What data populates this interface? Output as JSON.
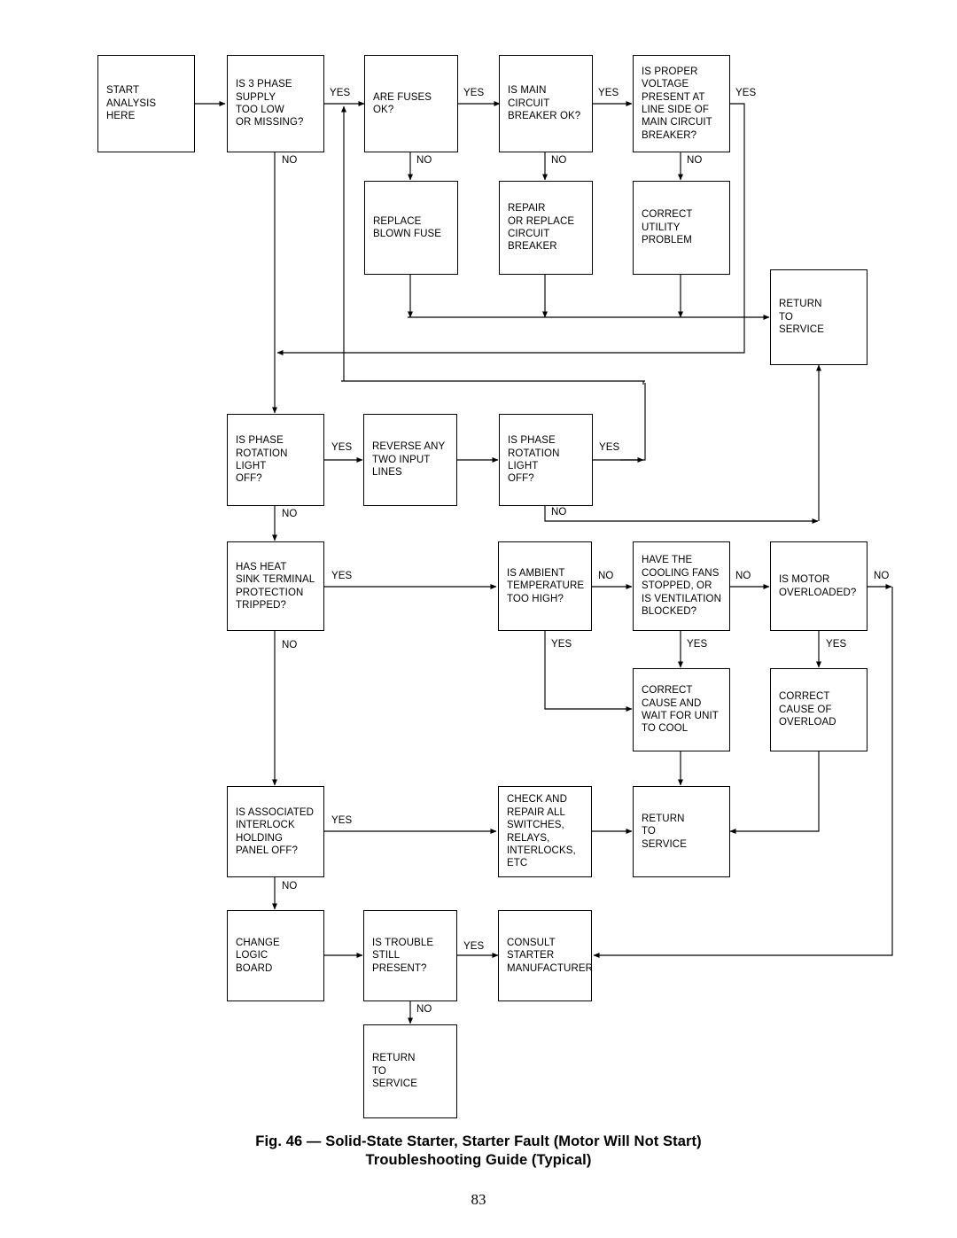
{
  "figure": {
    "caption_line1": "Fig. 46 — Solid-State Starter, Starter Fault (Motor Will Not Start)",
    "caption_line2": "Troubleshooting Guide (Typical)",
    "page_number": "83"
  },
  "colors": {
    "line": "#000000",
    "box_border": "#000000",
    "box_fill": "#ffffff",
    "text": "#000000",
    "background": "#ffffff"
  },
  "nodes": {
    "start_analysis": "START\nANALYSIS\nHERE",
    "supply_low": "IS 3 PHASE\nSUPPLY\nTOO LOW\nOR MISSING?",
    "fuses_ok": "ARE FUSES\nOK?",
    "main_breaker_ok": "IS MAIN\nCIRCUIT\nBREAKER OK?",
    "proper_voltage": "IS PROPER\nVOLTAGE\nPRESENT AT\nLINE SIDE OF\nMAIN CIRCUIT\nBREAKER?",
    "replace_fuse": "REPLACE\nBLOWN FUSE",
    "repair_breaker": "REPAIR\nOR REPLACE\nCIRCUIT\nBREAKER",
    "correct_utility": "CORRECT\nUTILITY\nPROBLEM",
    "return_service_1": "RETURN\nTO\nSERVICE",
    "phase_rotation_1": "IS PHASE\nROTATION\nLIGHT\nOFF?",
    "reverse_lines": "REVERSE ANY\nTWO INPUT\nLINES",
    "phase_rotation_2": "IS PHASE\nROTATION\nLIGHT\nOFF?",
    "heat_sink": "HAS HEAT\nSINK TERMINAL\nPROTECTION\nTRIPPED?",
    "ambient_temp": "IS AMBIENT\nTEMPERATURE\nTOO HIGH?",
    "cooling_fans": "HAVE THE\nCOOLING FANS\nSTOPPED, OR\nIS VENTILATION\nBLOCKED?",
    "motor_overloaded": "IS MOTOR\nOVERLOADED?",
    "correct_cool": "CORRECT\nCAUSE AND\nWAIT FOR UNIT\nTO COOL",
    "correct_overload": "CORRECT\nCAUSE OF\nOVERLOAD",
    "interlock": "IS ASSOCIATED\nINTERLOCK\nHOLDING\nPANEL OFF?",
    "check_repair": "CHECK AND\nREPAIR ALL\nSWITCHES,\nRELAYS,\nINTERLOCKS,\nETC",
    "return_service_2": "RETURN\nTO\nSERVICE",
    "change_logic": "CHANGE\nLOGIC\nBOARD",
    "trouble_still": "IS TROUBLE\nSTILL\nPRESENT?",
    "consult_mfr": "CONSULT\nSTARTER\nMANUFACTURER",
    "return_service_3": "RETURN\nTO\nSERVICE"
  },
  "edge_labels": {
    "supply_low_yes": "YES",
    "supply_low_no": "NO",
    "fuses_yes": "YES",
    "fuses_no": "NO",
    "breaker_yes": "YES",
    "breaker_no": "NO",
    "voltage_yes": "YES",
    "voltage_no": "NO",
    "rotation1_yes": "YES",
    "rotation1_no": "NO",
    "rotation2_yes": "YES",
    "rotation2_no": "NO",
    "heatsink_yes": "YES",
    "heatsink_no": "NO",
    "ambient_no": "NO",
    "ambient_yes": "YES",
    "fans_no": "NO",
    "fans_yes": "YES",
    "motor_no": "NO",
    "motor_yes": "YES",
    "interlock_yes": "YES",
    "interlock_no": "NO",
    "trouble_yes": "YES",
    "trouble_no": "NO"
  }
}
